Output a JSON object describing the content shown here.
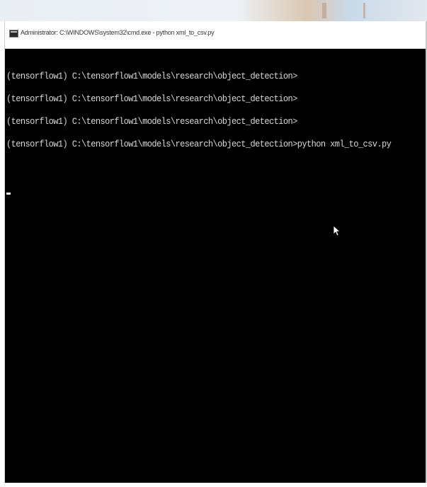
{
  "window": {
    "title": "Administrator: C:\\WINDOWS\\system32\\cmd.exe - python xml_to_csv.py"
  },
  "console": {
    "lines": [
      "(tensorflow1) C:\\tensorflow1\\models\\research\\object_detection>",
      "(tensorflow1) C:\\tensorflow1\\models\\research\\object_detection>",
      "(tensorflow1) C:\\tensorflow1\\models\\research\\object_detection>",
      "(tensorflow1) C:\\tensorflow1\\models\\research\\object_detection>python xml_to_csv.py"
    ]
  },
  "icons": {
    "title_icon": "cmd-icon",
    "pointer": "mouse-pointer-icon"
  },
  "colors": {
    "console_background": "#000000",
    "console_text": "#d8d8d8",
    "titlebar_background": "#ffffff"
  }
}
